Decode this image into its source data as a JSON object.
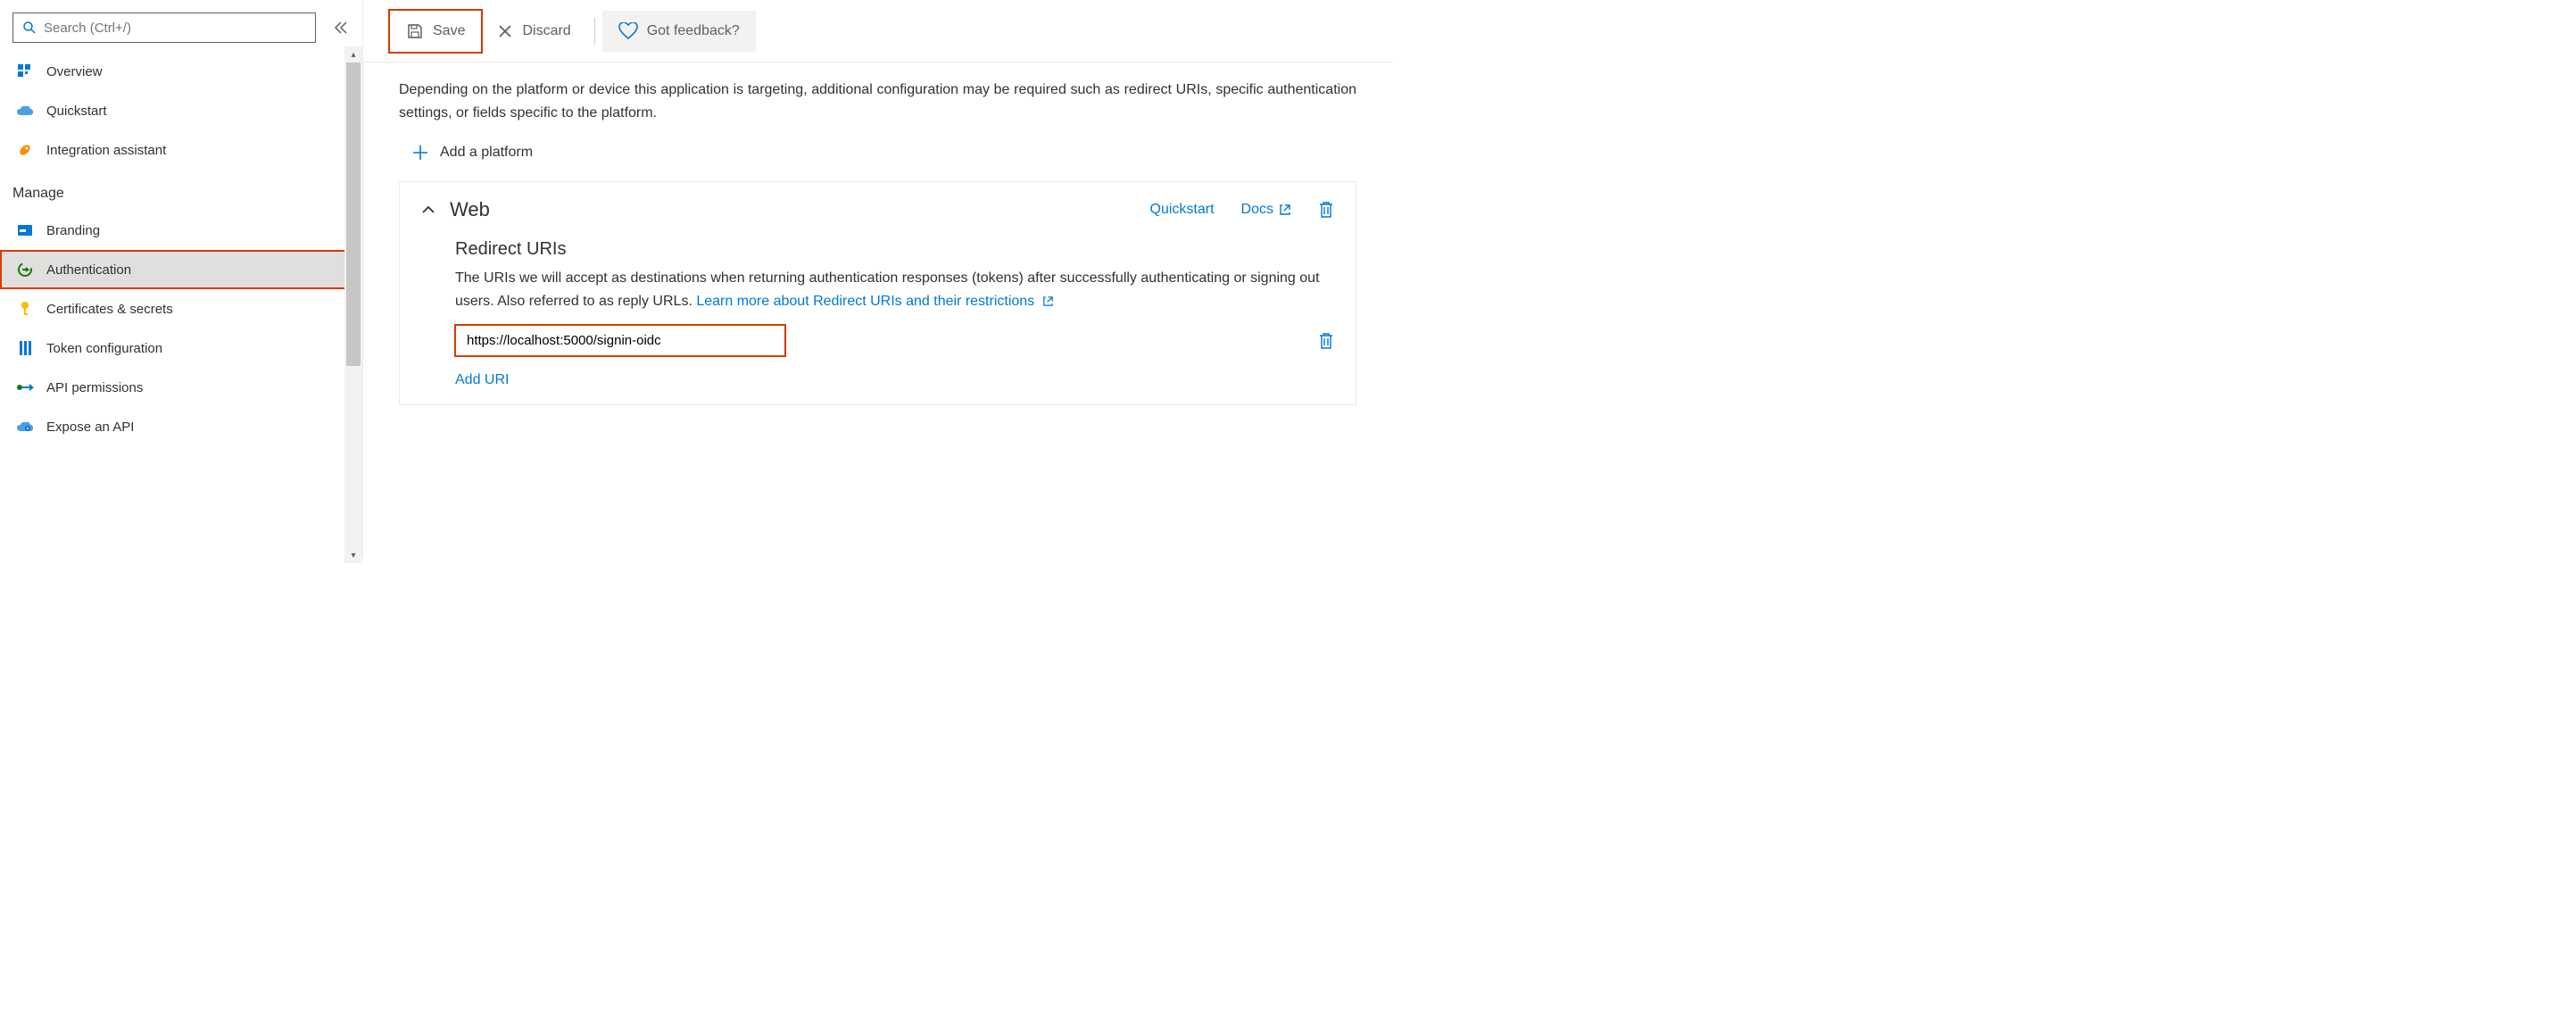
{
  "search": {
    "placeholder": "Search (Ctrl+/)"
  },
  "nav_top": [
    {
      "label": "Overview"
    },
    {
      "label": "Quickstart"
    },
    {
      "label": "Integration assistant"
    }
  ],
  "nav_manage_header": "Manage",
  "nav_manage": [
    {
      "label": "Branding"
    },
    {
      "label": "Authentication"
    },
    {
      "label": "Certificates & secrets"
    },
    {
      "label": "Token configuration"
    },
    {
      "label": "API permissions"
    },
    {
      "label": "Expose an API"
    }
  ],
  "cmd": {
    "save": "Save",
    "discard": "Discard",
    "feedback": "Got feedback?"
  },
  "main": {
    "desc": "Depending on the platform or device this application is targeting, additional configuration may be required such as redirect URIs, specific authentication settings, or fields specific to the platform.",
    "add_platform": "Add a platform",
    "web": {
      "title": "Web",
      "quickstart": "Quickstart",
      "docs": "Docs",
      "redirect_heading": "Redirect URIs",
      "redirect_text_a": "The URIs we will accept as destinations when returning authentication responses (tokens) after successfully authenticating or signing out users. Also referred to as reply URLs. ",
      "redirect_link": "Learn more about Redirect URIs and their restrictions",
      "uri_value": "https://localhost:5000/signin-oidc",
      "add_uri": "Add URI"
    }
  }
}
